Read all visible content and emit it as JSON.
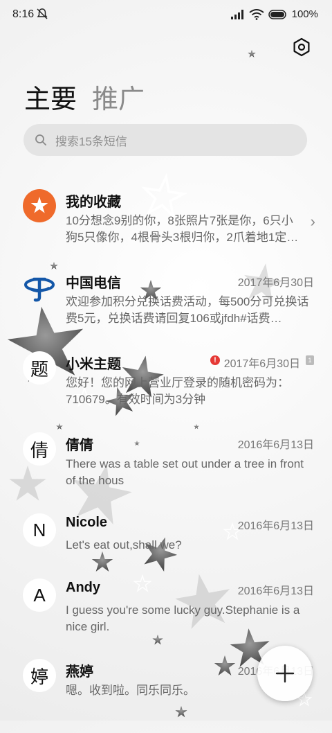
{
  "status": {
    "time": "8:16",
    "battery": "100%"
  },
  "tabs": {
    "primary": "主要",
    "secondary": "推广"
  },
  "search": {
    "placeholder": "搜索15条短信"
  },
  "conversations": [
    {
      "name": "我的收藏",
      "date": "",
      "preview": "10分想念9别的你，8张照片7张是你，6只小狗5只像你，4根骨头3根归你，2爪着地1定…",
      "avatar": "star-icon",
      "color": "#ef6a2b"
    },
    {
      "name": "中国电信",
      "date": "2017年6月30日",
      "preview": "欢迎参加积分兑换话费活动，每500分可兑换话费5元，兑换话费请回复106或jfdh#话费…",
      "avatar": "china-telecom-logo"
    },
    {
      "name": "小米主题",
      "date": "2017年6月30日",
      "preview": "您好！您的网上营业厅登录的随机密码为：710679。有效时间为3分钟",
      "avatar_letter": "题",
      "sim_label": "1"
    },
    {
      "name": "倩倩",
      "date": "2016年6月13日",
      "preview": "There was a table set out under a tree in front of the hous",
      "avatar_letter": "倩"
    },
    {
      "name": "Nicole",
      "date": "2016年6月13日",
      "preview": "Let's eat out,shall we?",
      "avatar_letter": "N"
    },
    {
      "name": "Andy",
      "date": "2016年6月13日",
      "preview": "I guess you're some lucky guy.Stephanie is a nice girl.",
      "avatar_letter": "A"
    },
    {
      "name": "燕婷",
      "date": "2016年6月13日",
      "preview": "嗯。收到啦。同乐同乐。",
      "avatar_letter": "婷"
    }
  ]
}
